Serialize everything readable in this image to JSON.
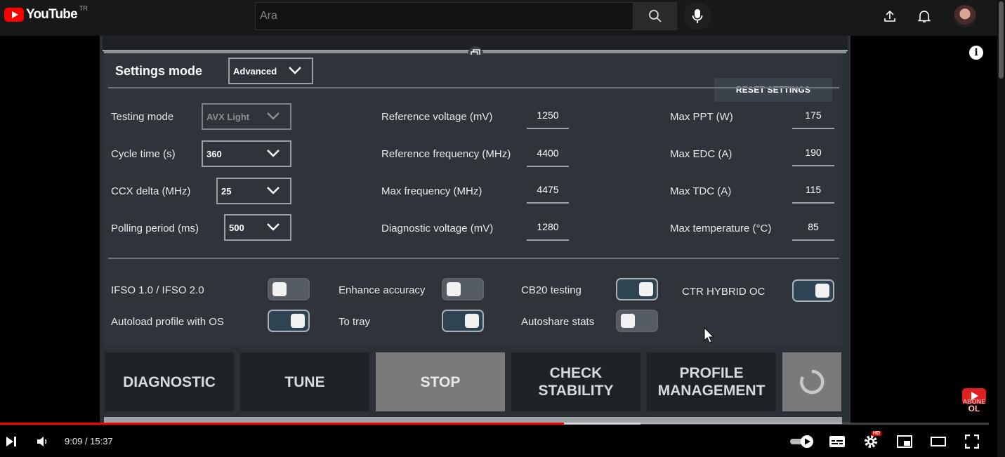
{
  "youtube": {
    "logo_text": "YouTube",
    "country_code": "TR",
    "search_placeholder": "Ara"
  },
  "app": {
    "settings_mode_label": "Settings mode",
    "settings_mode_value": "Advanced",
    "reset_label": "RESET SETTINGS",
    "left_fields": [
      {
        "label": "Testing mode",
        "value": "AVX Light",
        "disabled": true
      },
      {
        "label": "Cycle time (s)",
        "value": "360"
      },
      {
        "label": "CCX delta (MHz)",
        "value": "25"
      },
      {
        "label": "Polling period (ms)",
        "value": "500"
      }
    ],
    "middle_fields": [
      {
        "label": "Reference voltage (mV)",
        "value": "1250"
      },
      {
        "label": "Reference frequency (MHz)",
        "value": "4400"
      },
      {
        "label": "Max frequency (MHz)",
        "value": "4475"
      },
      {
        "label": "Diagnostic voltage (mV)",
        "value": "1280"
      }
    ],
    "right_fields": [
      {
        "label": "Max PPT (W)",
        "value": "175"
      },
      {
        "label": "Max EDC (A)",
        "value": "190"
      },
      {
        "label": "Max TDC (A)",
        "value": "115"
      },
      {
        "label": "Max temperature (°C)",
        "value": "85"
      }
    ],
    "toggles": [
      {
        "label": "IFSO 1.0 / IFSO 2.0",
        "on": false
      },
      {
        "label": "Autoload profile with OS",
        "on": true
      },
      {
        "label": "Enhance accuracy",
        "on": false
      },
      {
        "label": "To tray",
        "on": true
      },
      {
        "label": "CB20 testing",
        "on": true
      },
      {
        "label": "Autoshare stats",
        "on": false
      },
      {
        "label": "CTR HYBRID OC",
        "on": true
      }
    ],
    "buttons": {
      "diagnostic": "DIAGNOSTIC",
      "tune": "TUNE",
      "stop": "STOP",
      "check_line1": "CHECK",
      "check_line2": "STABILITY",
      "profile_line1": "PROFILE",
      "profile_line2": "MANAGEMENT"
    }
  },
  "subscribe_badge": {
    "line1": "ABONE",
    "line2": "OL"
  },
  "player": {
    "time": "9:09 / 15:37",
    "played_fraction": 0.57,
    "buffered_fraction": 0.648,
    "quality_badge": "HD"
  },
  "colors": {
    "accent": "#ff0000",
    "app_bg": "#2b3036",
    "toggle_on": "#2f4452"
  }
}
